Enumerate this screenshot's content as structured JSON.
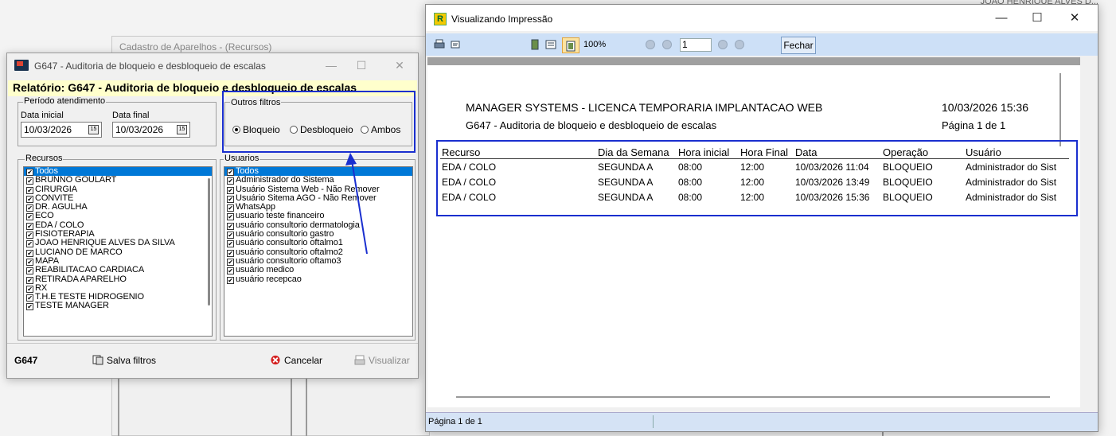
{
  "background": {
    "window_title": "Cadastro de Aparelhos - (Recursos)",
    "right_corner_text": "JOAO HENRIQUE ALVES D..."
  },
  "dialog": {
    "title": "G647 - Auditoria de bloqueio e desbloqueio de escalas",
    "report_label": "Relatório: G647 - Auditoria de bloqueio e desbloqueio de escalas",
    "periodo": {
      "group_label": "Período atendimento",
      "data_inicial_label": "Data inicial",
      "data_inicial_value": "10/03/2026",
      "data_final_label": "Data final",
      "data_final_value": "10/03/2026"
    },
    "outros_filtros": {
      "group_label": "Outros filtros",
      "options": [
        "Bloqueio",
        "Desbloqueio",
        "Ambos"
      ],
      "selected": "Bloqueio"
    },
    "recursos": {
      "group_label": "Recursos",
      "items": [
        "Todos",
        "BRUNNO GOULART",
        "CIRURGIA",
        "CONVITE",
        "DR. AGULHA",
        "ECO",
        "EDA / COLO",
        "FISIOTERAPIA",
        "JOAO HENRIQUE ALVES DA SILVA",
        "LUCIANO DE MARCO",
        "MAPA",
        "REABILITACAO CARDIACA",
        "RETIRADA APARELHO",
        "RX",
        "T.H.E  TESTE HIDROGENIO",
        "TESTE  MANAGER"
      ]
    },
    "usuarios": {
      "group_label": "Usuarios",
      "items": [
        "Todos",
        "Administrador do Sistema",
        "Usuário Sistema Web - Não Remover",
        "Usuário Sitema AGO - Não Remover",
        "WhatsApp",
        "usuario teste financeiro",
        "usuário consultorio dermatologia",
        "usuário consultorio gastro",
        "usuário consultorio oftalmo1",
        "usuário consultorio oftalmo2",
        "usuário consultorio oftamo3",
        "usuário medico",
        "usuário recepcao"
      ]
    },
    "footer": {
      "code": "G647",
      "salva_filtros": "Salva filtros",
      "cancelar": "Cancelar",
      "visualizar": "Visualizar"
    }
  },
  "preview": {
    "title": "Visualizando Impressão",
    "zoom": "100%",
    "page_input": "1",
    "fechar": "Fechar",
    "status": "Página 1 de 1",
    "report": {
      "company": "MANAGER SYSTEMS - LICENCA TEMPORARIA IMPLANTACAO WEB",
      "subtitle": "G647 - Auditoria de bloqueio e desbloqueio de escalas",
      "datetime": "10/03/2026 15:36",
      "page": "Página 1 de 1",
      "columns": [
        "Recurso",
        "Dia da Semana",
        "Hora inicial",
        "Hora Final",
        "Data",
        "Operação",
        "Usuário"
      ],
      "rows": [
        [
          "EDA / COLO",
          "SEGUNDA A",
          "08:00",
          "12:00",
          "10/03/2026 11:04",
          "BLOQUEIO",
          "Administrador do Sist"
        ],
        [
          "EDA / COLO",
          "SEGUNDA A",
          "08:00",
          "12:00",
          "10/03/2026 13:49",
          "BLOQUEIO",
          "Administrador do Sist"
        ],
        [
          "EDA / COLO",
          "SEGUNDA A",
          "08:00",
          "12:00",
          "10/03/2026 15:36",
          "BLOQUEIO",
          "Administrador do Sist"
        ]
      ]
    }
  },
  "icons": {
    "minimize": "minimize-icon",
    "maximize": "maximize-icon",
    "close": "close-icon"
  },
  "colors": {
    "highlight_blue": "#1a2fcf",
    "selection_blue": "#0078d7",
    "toolbar_blue": "#cde0f7",
    "report_banner_yellow": "#ffffcc"
  }
}
